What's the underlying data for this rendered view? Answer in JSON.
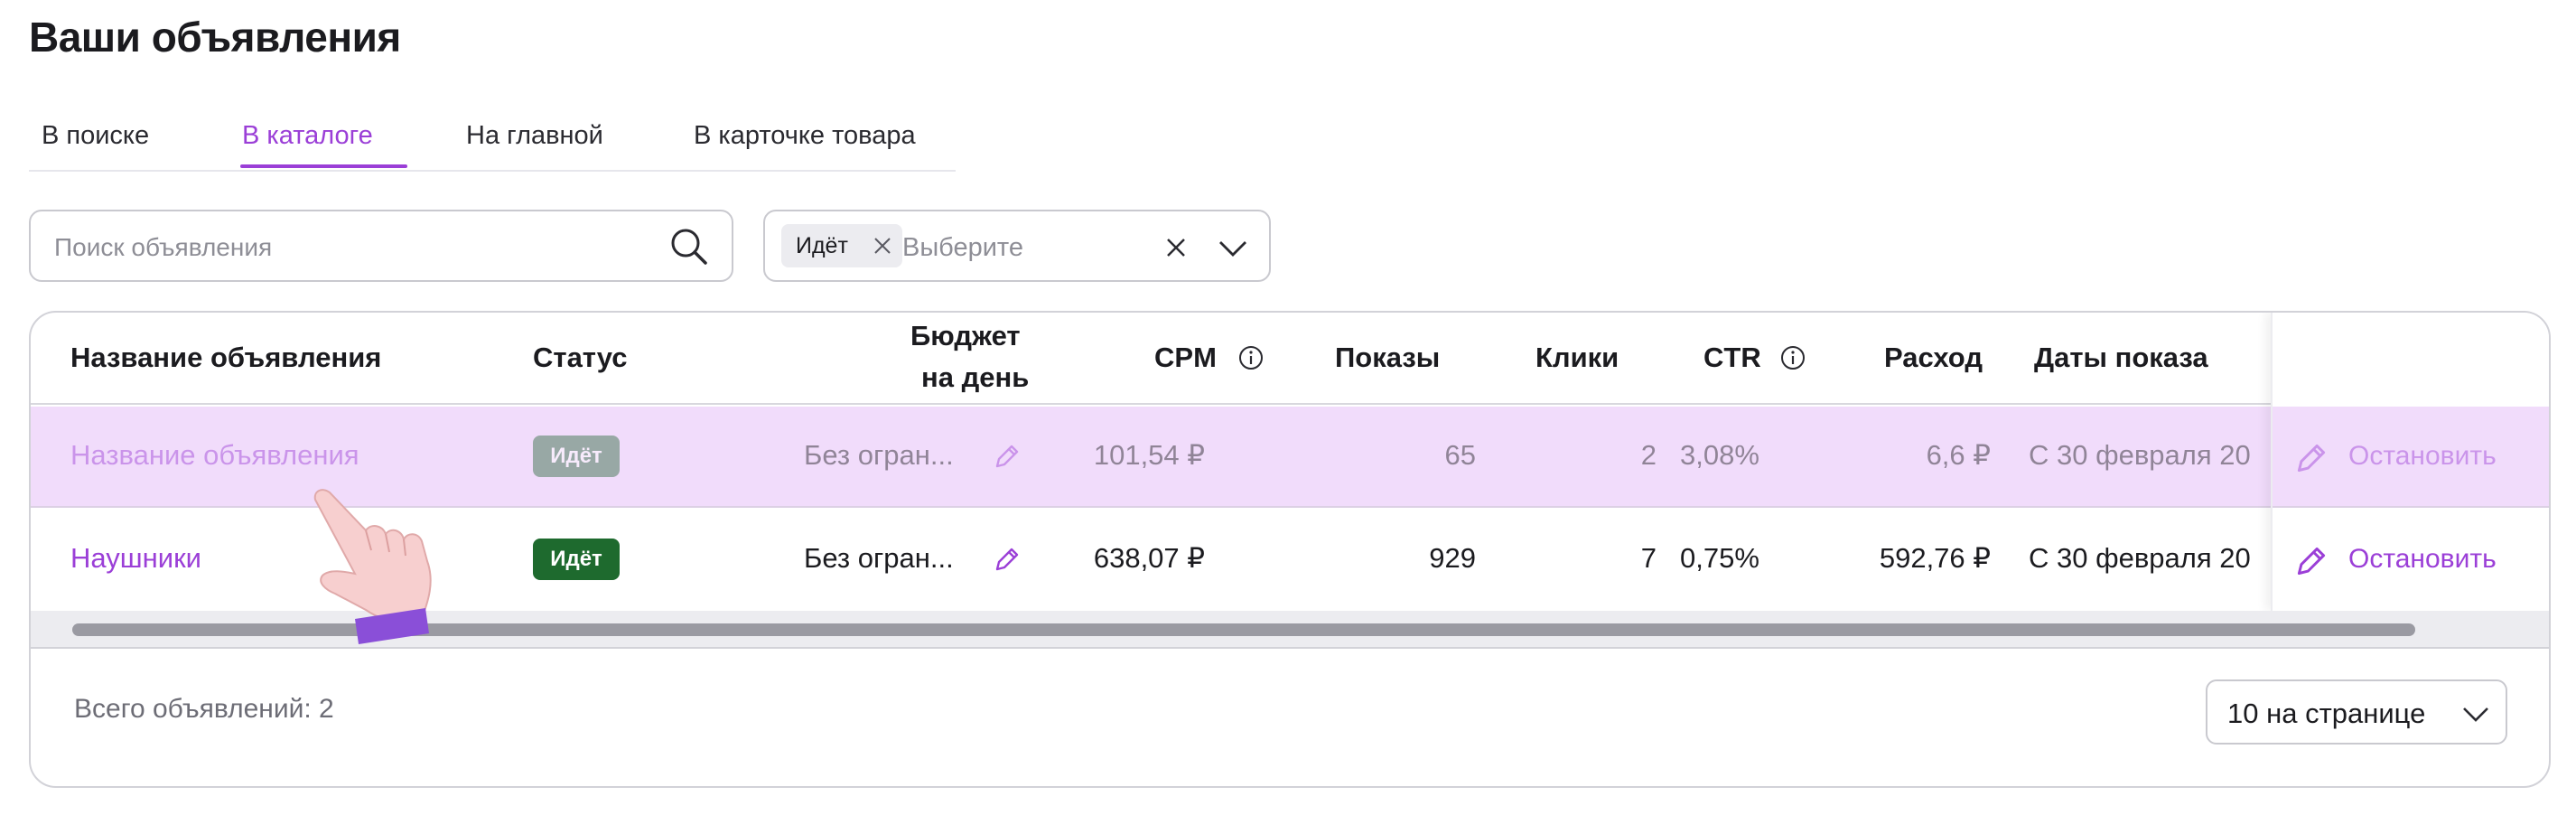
{
  "page": {
    "title": "Ваши объявления"
  },
  "tabs": [
    {
      "label": "В поиске",
      "active": false
    },
    {
      "label": "В каталоге",
      "active": true
    },
    {
      "label": "На главной",
      "active": false
    },
    {
      "label": "В карточке товара",
      "active": false
    }
  ],
  "search": {
    "placeholder": "Поиск объявления",
    "value": ""
  },
  "status_filter": {
    "chip": "Идёт",
    "placeholder": "Выберите"
  },
  "table": {
    "columns": {
      "name": "Название объявления",
      "status": "Статус",
      "budget_line1": "Бюджет",
      "budget_line2": "на день",
      "cpm": "CPM",
      "impressions": "Показы",
      "clicks": "Клики",
      "ctr": "CTR",
      "spend": "Расход",
      "dates": "Даты показа"
    },
    "rows": [
      {
        "name": "Название объявления",
        "status": "Идёт",
        "budget": "Без огран...",
        "cpm": "101,54 ₽",
        "impressions": "65",
        "clicks": "2",
        "ctr": "3,08%",
        "spend": "6,6 ₽",
        "dates": "С 30 февраля 20",
        "action": "Остановить"
      },
      {
        "name": "Наушники",
        "status": "Идёт",
        "budget": "Без огран...",
        "cpm": "638,07 ₽",
        "impressions": "929",
        "clicks": "7",
        "ctr": "0,75%",
        "spend": "592,76 ₽",
        "dates": "С 30 февраля 20",
        "action": "Остановить"
      }
    ],
    "total": "Всего объявлений: 2",
    "page_size": "10 на странице"
  },
  "colors": {
    "accent": "#9b3fd7",
    "status_green": "#1e6a2e",
    "row_highlight": "#f1dcfb"
  },
  "icons": [
    "search-icon",
    "close-icon",
    "chevron-down-icon",
    "info-icon",
    "pencil-icon",
    "pointer-hand-icon"
  ]
}
